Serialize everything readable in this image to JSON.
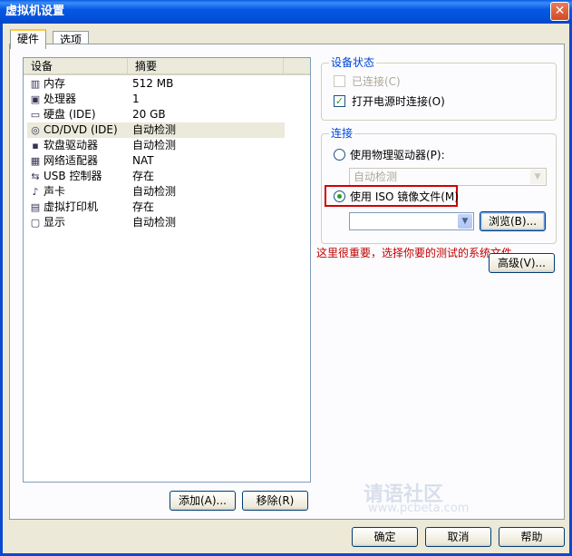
{
  "window": {
    "title": "虚拟机设置",
    "close_glyph": "✕"
  },
  "tabs": [
    {
      "label": "硬件"
    },
    {
      "label": "选项"
    }
  ],
  "device_list": {
    "columns": [
      "设备",
      "摘要"
    ],
    "rows": [
      {
        "icon": "memory-icon",
        "glyph": "▥",
        "name": "内存",
        "summary": "512 MB"
      },
      {
        "icon": "processor-icon",
        "glyph": "▣",
        "name": "处理器",
        "summary": "1"
      },
      {
        "icon": "harddisk-icon",
        "glyph": "▭",
        "name": "硬盘 (IDE)",
        "summary": "20 GB"
      },
      {
        "icon": "cdrom-icon",
        "glyph": "◎",
        "name": "CD/DVD (IDE)",
        "summary": "自动检测"
      },
      {
        "icon": "floppy-icon",
        "glyph": "▪",
        "name": "软盘驱动器",
        "summary": "自动检测"
      },
      {
        "icon": "network-icon",
        "glyph": "▦",
        "name": "网络适配器",
        "summary": "NAT"
      },
      {
        "icon": "usb-icon",
        "glyph": "⇆",
        "name": "USB 控制器",
        "summary": "存在"
      },
      {
        "icon": "sound-icon",
        "glyph": "♪",
        "name": "声卡",
        "summary": "自动检测"
      },
      {
        "icon": "printer-icon",
        "glyph": "▤",
        "name": "虚拟打印机",
        "summary": "存在"
      },
      {
        "icon": "display-icon",
        "glyph": "▢",
        "name": "显示",
        "summary": "自动检测"
      }
    ],
    "selected_index": 3
  },
  "list_buttons": {
    "add": "添加(A)...",
    "remove": "移除(R)"
  },
  "device_status": {
    "title": "设备状态",
    "connected_label": "已连接(C)",
    "power_on_label": "打开电源时连接(O)",
    "check_glyph": "✓"
  },
  "connection": {
    "title": "连接",
    "physical_label": "使用物理驱动器(P):",
    "physical_value": "自动检测",
    "iso_label": "使用 ISO 镜像文件(M)",
    "iso_value": "",
    "browse_label": "浏览(B)...",
    "arrow_glyph": "▼"
  },
  "annotation": "这里很重要，选择你要的测试的系统文件",
  "advanced_label": "高级(V)...",
  "dialog_buttons": {
    "ok": "确定",
    "cancel": "取消",
    "help": "帮助"
  },
  "watermark": {
    "main": "请语社区",
    "sub": "www.pcbeta.com"
  },
  "colors": {
    "title_bar": "#0757e6",
    "group_title": "#0046d5",
    "annotation": "#c00000",
    "highlight": "#d20000"
  }
}
